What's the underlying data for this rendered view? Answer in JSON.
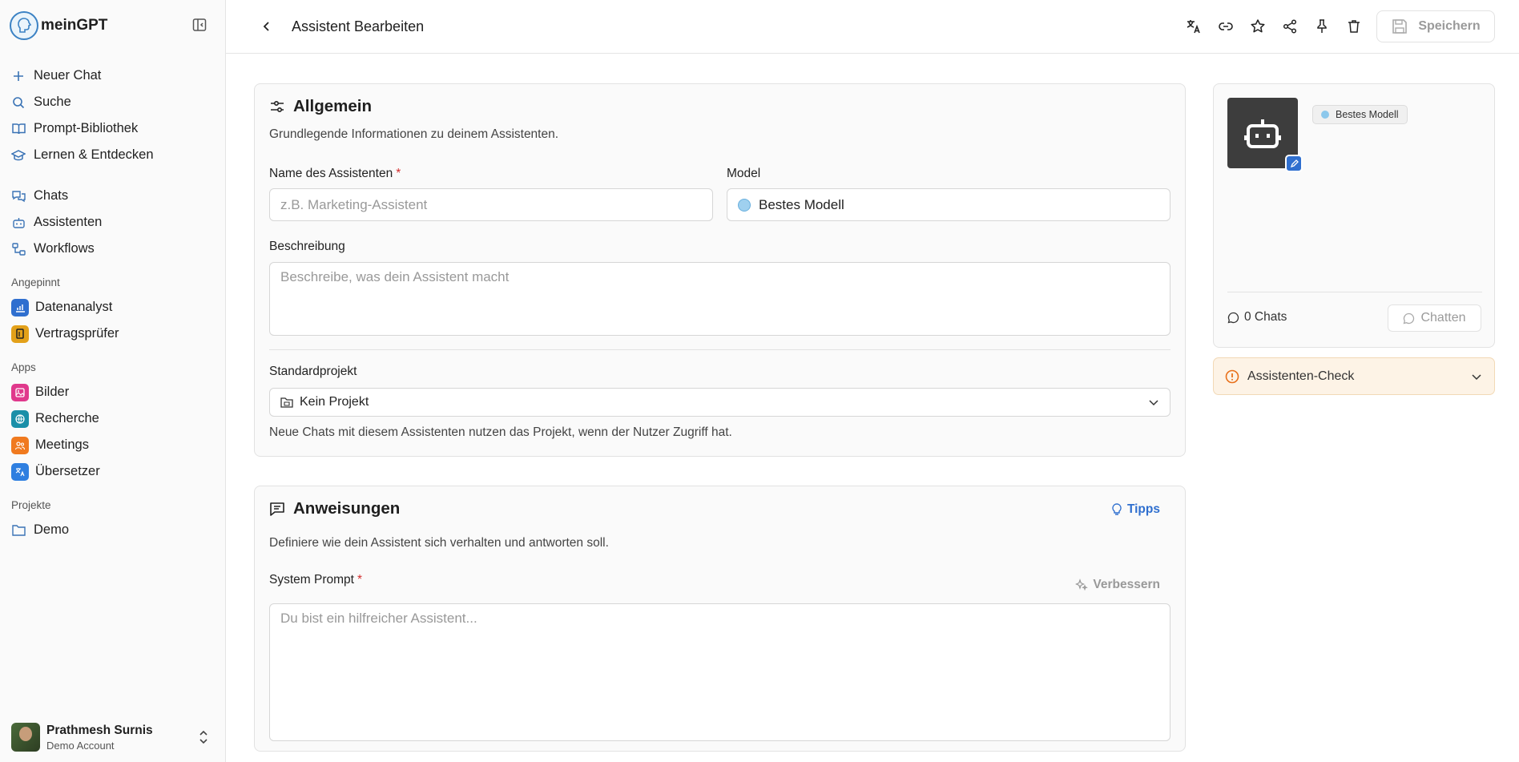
{
  "brand": {
    "name": "meinGPT"
  },
  "sidebar": {
    "primary": [
      {
        "label": "Neuer Chat",
        "icon": "plus-icon"
      },
      {
        "label": "Suche",
        "icon": "search-icon"
      },
      {
        "label": "Prompt-Bibliothek",
        "icon": "book-icon"
      },
      {
        "label": "Lernen & Entdecken",
        "icon": "graduation-cap-icon"
      }
    ],
    "secondary": [
      {
        "label": "Chats",
        "icon": "chats-icon"
      },
      {
        "label": "Assistenten",
        "icon": "bot-icon"
      },
      {
        "label": "Workflows",
        "icon": "workflow-icon"
      }
    ],
    "pinned_label": "Angepinnt",
    "pinned": [
      {
        "label": "Datenanalyst",
        "icon": "chart-icon",
        "color": "#2f6fcf"
      },
      {
        "label": "Vertragsprüfer",
        "icon": "document-icon",
        "color": "#e3a11a"
      }
    ],
    "apps_label": "Apps",
    "apps": [
      {
        "label": "Bilder",
        "icon": "image-icon",
        "color": "#e0398c"
      },
      {
        "label": "Recherche",
        "icon": "globe-icon",
        "color": "#1a8fa8"
      },
      {
        "label": "Meetings",
        "icon": "people-icon",
        "color": "#f07a1f"
      },
      {
        "label": "Übersetzer",
        "icon": "translate-icon",
        "color": "#2f7fe0"
      }
    ],
    "projects_label": "Projekte",
    "projects": [
      {
        "label": "Demo",
        "icon": "folder-icon"
      }
    ],
    "user": {
      "name": "Prathmesh Surnis",
      "account": "Demo Account"
    }
  },
  "header": {
    "title": "Assistent Bearbeiten",
    "save_label": "Speichern"
  },
  "general": {
    "title": "Allgemein",
    "subtitle": "Grundlegende Informationen zu deinem Assistenten.",
    "name_label": "Name des Assistenten",
    "required_mark": "*",
    "name_placeholder": "z.B. Marketing-Assistent",
    "model_label": "Model",
    "model_value": "Bestes Modell",
    "description_label": "Beschreibung",
    "description_placeholder": "Beschreibe, was dein Assistent macht",
    "project_label": "Standardprojekt",
    "project_value": "Kein Projekt",
    "project_hint": "Neue Chats mit diesem Assistenten nutzen das Projekt, wenn der Nutzer Zugriff hat."
  },
  "instructions": {
    "title": "Anweisungen",
    "tips_label": "Tipps",
    "subtitle": "Definiere wie dein Assistent sich verhalten und antworten soll.",
    "prompt_label": "System Prompt",
    "required_mark": "*",
    "improve_label": "Verbessern",
    "prompt_placeholder": "Du bist ein hilfreicher Assistent..."
  },
  "preview": {
    "model_chip": "Bestes Modell",
    "chats_count": "0 Chats",
    "chat_button": "Chatten"
  },
  "check": {
    "label": "Assistenten-Check",
    "color": "#e8701a"
  }
}
